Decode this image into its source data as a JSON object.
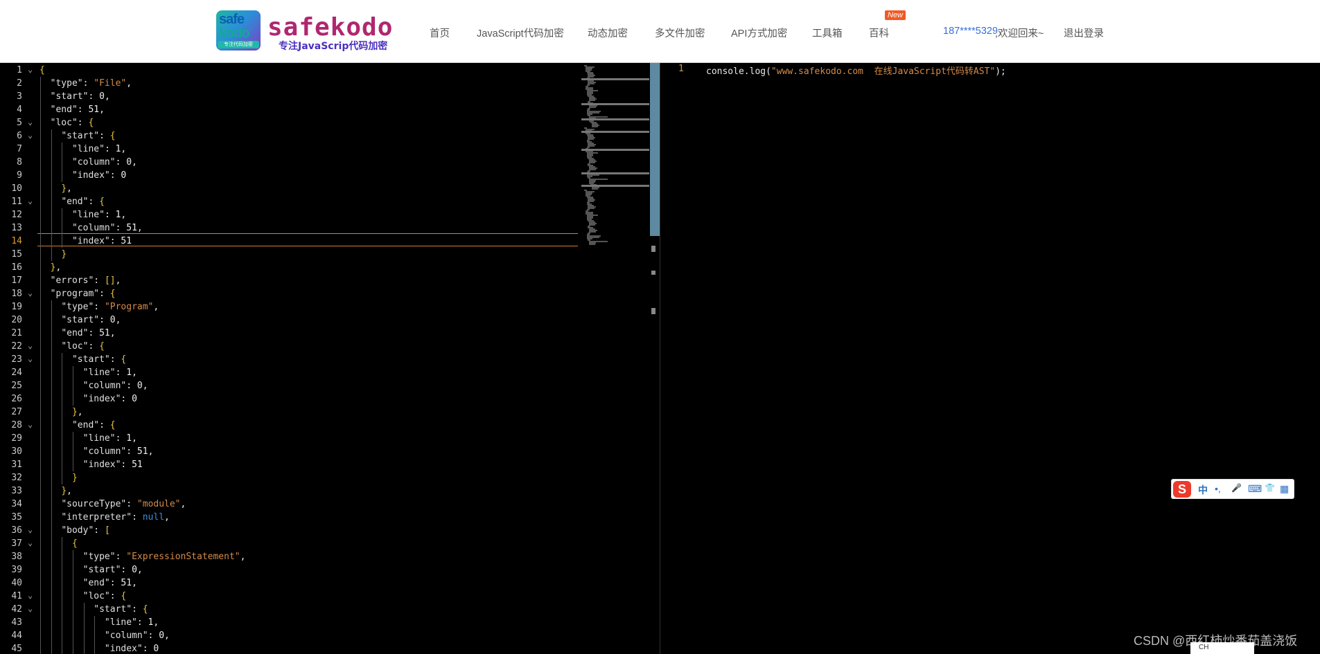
{
  "header": {
    "logo": {
      "badge_top": "safe",
      "badge_bottom": "kodo",
      "badge_ribbon": "专注代码加密",
      "name": "safekodo",
      "slogan": "专注JavaScrip代码加密"
    },
    "nav": [
      {
        "label": "首页"
      },
      {
        "label": "JavaScript代码加密"
      },
      {
        "label": "动态加密"
      },
      {
        "label": "多文件加密"
      },
      {
        "label": "API方式加密"
      },
      {
        "label": "工具箱"
      },
      {
        "label": "百科"
      }
    ],
    "new_badge": "New",
    "user_phone": "187****5329",
    "user_welcome": ",欢迎回来~",
    "logout": "退出登录"
  },
  "left_editor": {
    "current_line": 14,
    "lines": [
      "{",
      "  \"type\": \"File\",",
      "  \"start\": 0,",
      "  \"end\": 51,",
      "  \"loc\": {",
      "    \"start\": {",
      "      \"line\": 1,",
      "      \"column\": 0,",
      "      \"index\": 0",
      "    },",
      "    \"end\": {",
      "      \"line\": 1,",
      "      \"column\": 51,",
      "      \"index\": 51",
      "    }",
      "  },",
      "  \"errors\": [],",
      "  \"program\": {",
      "    \"type\": \"Program\",",
      "    \"start\": 0,",
      "    \"end\": 51,",
      "    \"loc\": {",
      "      \"start\": {",
      "        \"line\": 1,",
      "        \"column\": 0,",
      "        \"index\": 0",
      "      },",
      "      \"end\": {",
      "        \"line\": 1,",
      "        \"column\": 51,",
      "        \"index\": 51",
      "      }",
      "    },",
      "    \"sourceType\": \"module\",",
      "    \"interpreter\": null,",
      "    \"body\": [",
      "      {",
      "        \"type\": \"ExpressionStatement\",",
      "        \"start\": 0,",
      "        \"end\": 51,",
      "        \"loc\": {",
      "          \"start\": {",
      "            \"line\": 1,",
      "            \"column\": 0,",
      "            \"index\": 0"
    ],
    "folded_lines": [
      1,
      5,
      6,
      11,
      18,
      22,
      23,
      28,
      36,
      37,
      41,
      42
    ]
  },
  "right_editor": {
    "line_number": "1",
    "code": "console.log(\"www.safekodo.com  在线JavaScript代码转AST\");"
  },
  "ime_toolbar": {
    "logo": "S",
    "items": [
      "中",
      "•,",
      "🎤",
      "⌨",
      "👕",
      "▦"
    ]
  },
  "watermark": "CSDN @西红柿炒番茄盖浇饭",
  "tray_text": "CH"
}
